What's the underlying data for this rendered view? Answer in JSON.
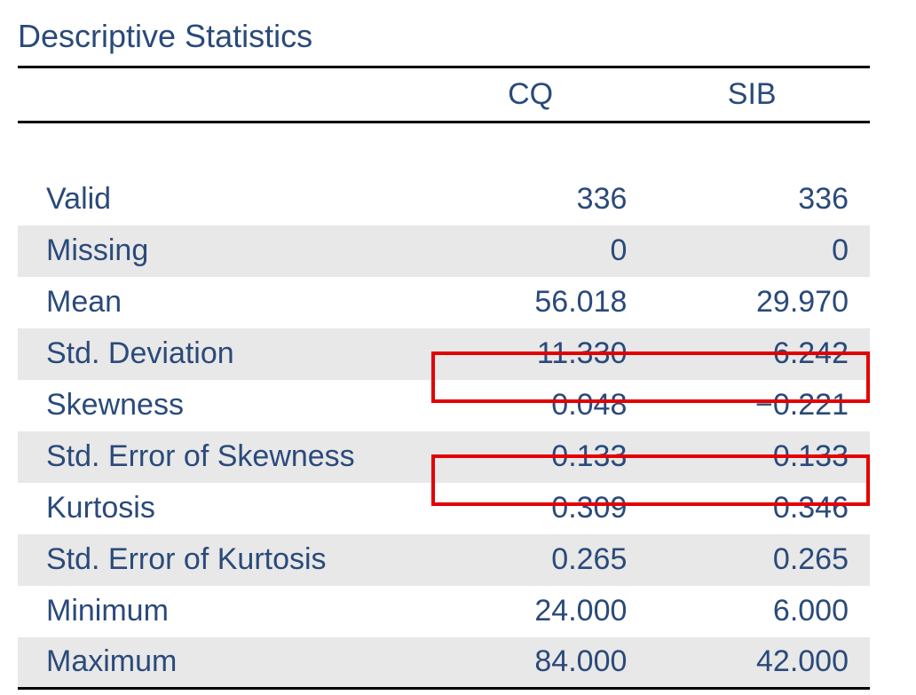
{
  "title": "Descriptive Statistics",
  "columns": {
    "c1": "CQ",
    "c2": "SIB"
  },
  "rows": {
    "valid": {
      "label": "Valid",
      "cq": "336",
      "sib": "336"
    },
    "missing": {
      "label": "Missing",
      "cq": "0",
      "sib": "0"
    },
    "mean": {
      "label": "Mean",
      "cq": "56.018",
      "sib": "29.970"
    },
    "stddev": {
      "label": "Std. Deviation",
      "cq": "11.330",
      "sib": "6.242"
    },
    "skew": {
      "label": "Skewness",
      "cq": "0.048",
      "sib": "−0.221"
    },
    "seskew": {
      "label": "Std. Error of Skewness",
      "cq": "0.133",
      "sib": "0.133"
    },
    "kurt": {
      "label": "Kurtosis",
      "cq": "0.309",
      "sib": "0.346"
    },
    "sekurt": {
      "label": "Std. Error of Kurtosis",
      "cq": "0.265",
      "sib": "0.265"
    },
    "min": {
      "label": "Minimum",
      "cq": "24.000",
      "sib": "6.000"
    },
    "max": {
      "label": "Maximum",
      "cq": "84.000",
      "sib": "42.000"
    }
  }
}
